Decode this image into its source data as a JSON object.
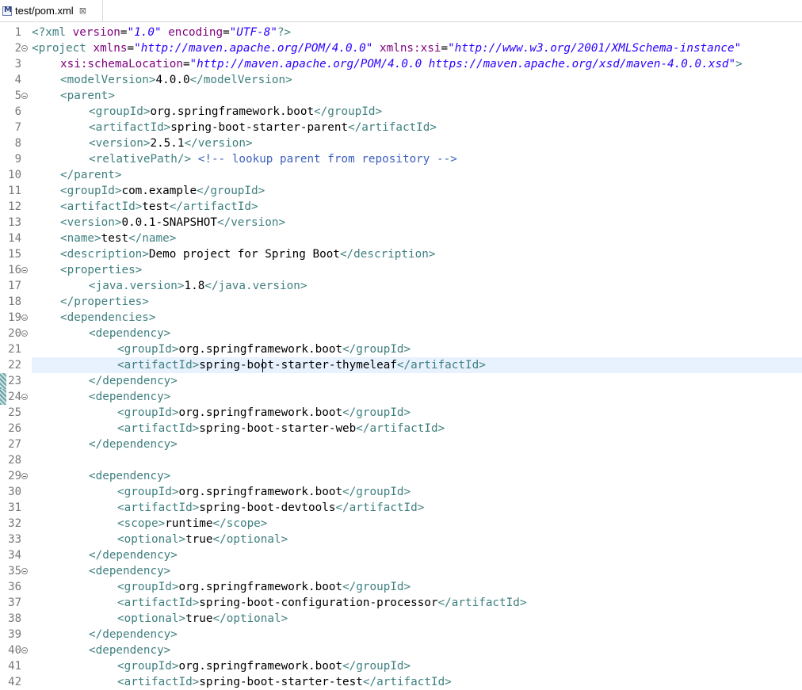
{
  "tab": {
    "title": "test/pom.xml",
    "icon": "maven-file-icon",
    "close_glyph": "⊠"
  },
  "current_line": 22,
  "lines": [
    {
      "n": "1",
      "fold": false,
      "indent": 0,
      "tokens": [
        [
          "pi",
          "<?xml "
        ],
        [
          "an",
          "version"
        ],
        [
          "tx",
          "="
        ],
        [
          "av",
          "\"1.0\""
        ],
        [
          "tx",
          " "
        ],
        [
          "an",
          "encoding"
        ],
        [
          "tx",
          "="
        ],
        [
          "av",
          "\"UTF-8\""
        ],
        [
          "pi",
          "?>"
        ]
      ]
    },
    {
      "n": "2",
      "fold": true,
      "indent": 0,
      "tokens": [
        [
          "tag",
          "<project "
        ],
        [
          "an",
          "xmlns"
        ],
        [
          "tx",
          "="
        ],
        [
          "av",
          "\"http://maven.apache.org/POM/4.0.0\""
        ],
        [
          "tx",
          " "
        ],
        [
          "an",
          "xmlns:xsi"
        ],
        [
          "tx",
          "="
        ],
        [
          "av",
          "\"http://www.w3.org/2001/XMLSchema-instance\""
        ]
      ]
    },
    {
      "n": "3",
      "fold": false,
      "indent": 1,
      "tokens": [
        [
          "an",
          "xsi:schemaLocation"
        ],
        [
          "tx",
          "="
        ],
        [
          "av",
          "\"http://maven.apache.org/POM/4.0.0 https://maven.apache.org/xsd/maven-4.0.0.xsd\""
        ],
        [
          "tag",
          ">"
        ]
      ]
    },
    {
      "n": "4",
      "fold": false,
      "indent": 1,
      "tokens": [
        [
          "tag",
          "<modelVersion>"
        ],
        [
          "tx",
          "4.0.0"
        ],
        [
          "tag",
          "</modelVersion>"
        ]
      ]
    },
    {
      "n": "5",
      "fold": true,
      "indent": 1,
      "tokens": [
        [
          "tag",
          "<parent>"
        ]
      ]
    },
    {
      "n": "6",
      "fold": false,
      "indent": 2,
      "tokens": [
        [
          "tag",
          "<groupId>"
        ],
        [
          "tx",
          "org.springframework.boot"
        ],
        [
          "tag",
          "</groupId>"
        ]
      ]
    },
    {
      "n": "7",
      "fold": false,
      "indent": 2,
      "tokens": [
        [
          "tag",
          "<artifactId>"
        ],
        [
          "tx",
          "spring-boot-starter-parent"
        ],
        [
          "tag",
          "</artifactId>"
        ]
      ]
    },
    {
      "n": "8",
      "fold": false,
      "indent": 2,
      "tokens": [
        [
          "tag",
          "<version>"
        ],
        [
          "tx",
          "2.5.1"
        ],
        [
          "tag",
          "</version>"
        ]
      ]
    },
    {
      "n": "9",
      "fold": false,
      "indent": 2,
      "tokens": [
        [
          "tag",
          "<relativePath/>"
        ],
        [
          "tx",
          " "
        ],
        [
          "cm",
          "<!-- lookup parent from repository -->"
        ]
      ]
    },
    {
      "n": "10",
      "fold": false,
      "indent": 1,
      "tokens": [
        [
          "tag",
          "</parent>"
        ]
      ]
    },
    {
      "n": "11",
      "fold": false,
      "indent": 1,
      "tokens": [
        [
          "tag",
          "<groupId>"
        ],
        [
          "tx",
          "com.example"
        ],
        [
          "tag",
          "</groupId>"
        ]
      ]
    },
    {
      "n": "12",
      "fold": false,
      "indent": 1,
      "tokens": [
        [
          "tag",
          "<artifactId>"
        ],
        [
          "tx",
          "test"
        ],
        [
          "tag",
          "</artifactId>"
        ]
      ]
    },
    {
      "n": "13",
      "fold": false,
      "indent": 1,
      "tokens": [
        [
          "tag",
          "<version>"
        ],
        [
          "tx",
          "0.0.1-SNAPSHOT"
        ],
        [
          "tag",
          "</version>"
        ]
      ]
    },
    {
      "n": "14",
      "fold": false,
      "indent": 1,
      "tokens": [
        [
          "tag",
          "<name>"
        ],
        [
          "tx",
          "test"
        ],
        [
          "tag",
          "</name>"
        ]
      ]
    },
    {
      "n": "15",
      "fold": false,
      "indent": 1,
      "tokens": [
        [
          "tag",
          "<description>"
        ],
        [
          "tx",
          "Demo project for Spring Boot"
        ],
        [
          "tag",
          "</description>"
        ]
      ]
    },
    {
      "n": "16",
      "fold": true,
      "indent": 1,
      "tokens": [
        [
          "tag",
          "<properties>"
        ]
      ]
    },
    {
      "n": "17",
      "fold": false,
      "indent": 2,
      "tokens": [
        [
          "tag",
          "<java.version>"
        ],
        [
          "tx",
          "1.8"
        ],
        [
          "tag",
          "</java.version>"
        ]
      ]
    },
    {
      "n": "18",
      "fold": false,
      "indent": 1,
      "tokens": [
        [
          "tag",
          "</properties>"
        ]
      ]
    },
    {
      "n": "19",
      "fold": true,
      "indent": 1,
      "tokens": [
        [
          "tag",
          "<dependencies>"
        ]
      ]
    },
    {
      "n": "20",
      "fold": true,
      "indent": 2,
      "tokens": [
        [
          "tag",
          "<dependency>"
        ]
      ]
    },
    {
      "n": "21",
      "fold": false,
      "indent": 3,
      "tokens": [
        [
          "tag",
          "<groupId>"
        ],
        [
          "tx",
          "org.springframework.boot"
        ],
        [
          "tag",
          "</groupId>"
        ]
      ]
    },
    {
      "n": "22",
      "fold": false,
      "indent": 3,
      "tokens": [
        [
          "tag",
          "<artifactId>"
        ],
        [
          "tx",
          "spring-boot-starter-thymeleaf"
        ],
        [
          "tag",
          "</artifactId>"
        ]
      ]
    },
    {
      "n": "23",
      "fold": false,
      "indent": 2,
      "tokens": [
        [
          "tag",
          "</dependency>"
        ]
      ]
    },
    {
      "n": "24",
      "fold": true,
      "indent": 2,
      "tokens": [
        [
          "tag",
          "<dependency>"
        ]
      ]
    },
    {
      "n": "25",
      "fold": false,
      "indent": 3,
      "tokens": [
        [
          "tag",
          "<groupId>"
        ],
        [
          "tx",
          "org.springframework.boot"
        ],
        [
          "tag",
          "</groupId>"
        ]
      ]
    },
    {
      "n": "26",
      "fold": false,
      "indent": 3,
      "tokens": [
        [
          "tag",
          "<artifactId>"
        ],
        [
          "tx",
          "spring-boot-starter-web"
        ],
        [
          "tag",
          "</artifactId>"
        ]
      ]
    },
    {
      "n": "27",
      "fold": false,
      "indent": 2,
      "tokens": [
        [
          "tag",
          "</dependency>"
        ]
      ]
    },
    {
      "n": "28",
      "fold": false,
      "indent": 0,
      "tokens": []
    },
    {
      "n": "29",
      "fold": true,
      "indent": 2,
      "tokens": [
        [
          "tag",
          "<dependency>"
        ]
      ]
    },
    {
      "n": "30",
      "fold": false,
      "indent": 3,
      "tokens": [
        [
          "tag",
          "<groupId>"
        ],
        [
          "tx",
          "org.springframework.boot"
        ],
        [
          "tag",
          "</groupId>"
        ]
      ]
    },
    {
      "n": "31",
      "fold": false,
      "indent": 3,
      "tokens": [
        [
          "tag",
          "<artifactId>"
        ],
        [
          "tx",
          "spring-boot-devtools"
        ],
        [
          "tag",
          "</artifactId>"
        ]
      ]
    },
    {
      "n": "32",
      "fold": false,
      "indent": 3,
      "tokens": [
        [
          "tag",
          "<scope>"
        ],
        [
          "tx",
          "runtime"
        ],
        [
          "tag",
          "</scope>"
        ]
      ]
    },
    {
      "n": "33",
      "fold": false,
      "indent": 3,
      "tokens": [
        [
          "tag",
          "<optional>"
        ],
        [
          "tx",
          "true"
        ],
        [
          "tag",
          "</optional>"
        ]
      ]
    },
    {
      "n": "34",
      "fold": false,
      "indent": 2,
      "tokens": [
        [
          "tag",
          "</dependency>"
        ]
      ]
    },
    {
      "n": "35",
      "fold": true,
      "indent": 2,
      "tokens": [
        [
          "tag",
          "<dependency>"
        ]
      ]
    },
    {
      "n": "36",
      "fold": false,
      "indent": 3,
      "tokens": [
        [
          "tag",
          "<groupId>"
        ],
        [
          "tx",
          "org.springframework.boot"
        ],
        [
          "tag",
          "</groupId>"
        ]
      ]
    },
    {
      "n": "37",
      "fold": false,
      "indent": 3,
      "tokens": [
        [
          "tag",
          "<artifactId>"
        ],
        [
          "tx",
          "spring-boot-configuration-processor"
        ],
        [
          "tag",
          "</artifactId>"
        ]
      ]
    },
    {
      "n": "38",
      "fold": false,
      "indent": 3,
      "tokens": [
        [
          "tag",
          "<optional>"
        ],
        [
          "tx",
          "true"
        ],
        [
          "tag",
          "</optional>"
        ]
      ]
    },
    {
      "n": "39",
      "fold": false,
      "indent": 2,
      "tokens": [
        [
          "tag",
          "</dependency>"
        ]
      ]
    },
    {
      "n": "40",
      "fold": true,
      "indent": 2,
      "tokens": [
        [
          "tag",
          "<dependency>"
        ]
      ]
    },
    {
      "n": "41",
      "fold": false,
      "indent": 3,
      "tokens": [
        [
          "tag",
          "<groupId>"
        ],
        [
          "tx",
          "org.springframework.boot"
        ],
        [
          "tag",
          "</groupId>"
        ]
      ]
    },
    {
      "n": "42",
      "fold": false,
      "indent": 3,
      "tokens": [
        [
          "tag",
          "<artifactId>"
        ],
        [
          "tx",
          "spring-boot-starter-test"
        ],
        [
          "tag",
          "</artifactId>"
        ]
      ]
    }
  ],
  "colors": {
    "tag": "#3f7f7f",
    "attribute_name": "#7f007f",
    "attribute_value": "#2a00ff",
    "comment": "#3f5fbf",
    "current_line_bg": "#e8f2fe",
    "line_number": "#787878"
  }
}
